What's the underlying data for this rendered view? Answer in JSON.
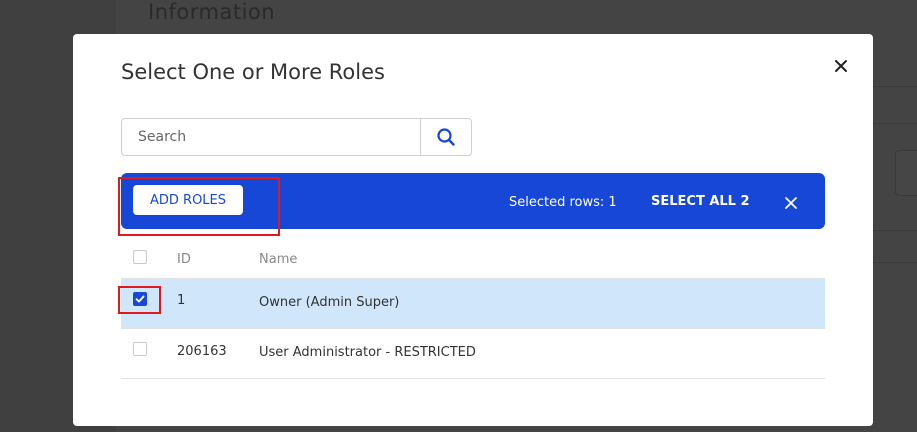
{
  "background": {
    "title": "Information"
  },
  "modal": {
    "title": "Select One or More Roles",
    "search": {
      "placeholder": "Search",
      "value": ""
    },
    "action_bar": {
      "add_roles_label": "ADD ROLES",
      "selected_rows_text": "Selected rows: 1",
      "select_all_label": "SELECT ALL 2"
    },
    "table": {
      "columns": [
        "ID",
        "Name"
      ],
      "rows": [
        {
          "id": "1",
          "name": "Owner (Admin Super)",
          "checked": true
        },
        {
          "id": "206163",
          "name": "User Administrator - RESTRICTED",
          "checked": false
        }
      ]
    }
  },
  "colors": {
    "accent": "#1747d6",
    "selected_row": "#cfe6fb",
    "highlight": "#e0191f"
  }
}
